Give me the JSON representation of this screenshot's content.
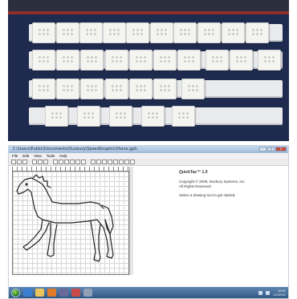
{
  "photo": {
    "description_free": true,
    "rows": [
      11,
      10,
      7,
      5
    ]
  },
  "window": {
    "title": "C:\\Users\\Public\\Documents\\Duxbury\\SpeedGraphic\\Horse.gph",
    "menu": [
      "File",
      "Edit",
      "View",
      "Tools",
      "Help"
    ]
  },
  "about": {
    "app_name": "QuickTac™ 1.0",
    "copyright": "Copyright © 2008, Duxbury Systems, Inc.",
    "rights": "All Rights Reserved.",
    "hint": "Select a drawing tool to get started."
  },
  "taskbar": {
    "clock_time": "10:51",
    "clock_date": "1/1/2012"
  },
  "colors": {
    "board": "#1f2b4e",
    "strip": "#e9eaec",
    "taskbar": "#2f5884"
  }
}
